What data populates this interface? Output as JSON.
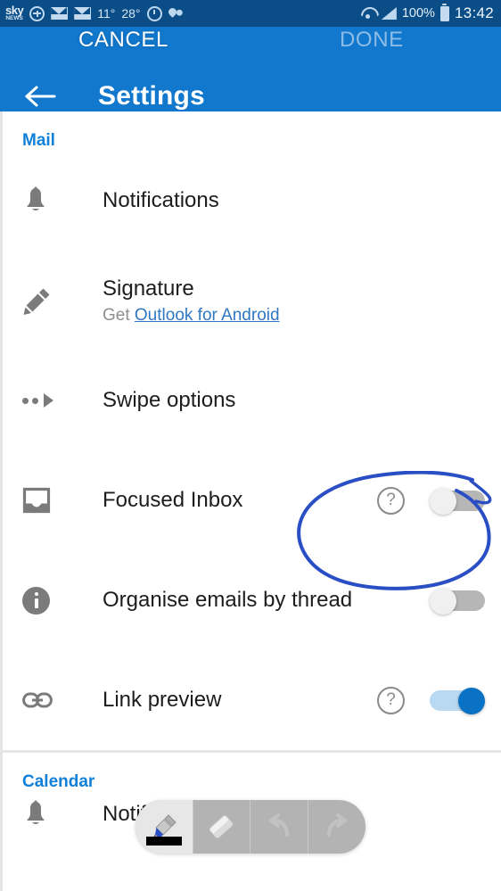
{
  "status_bar": {
    "app_logo_top": "sky",
    "app_logo_bottom": "NEWS",
    "sync_icon": "sync-icon",
    "mail_icon_1": "mail-icon",
    "mail_icon_2": "mail-icon",
    "temp_1": "11°",
    "temp_2": "28°",
    "alarm_icon": "alarm-icon",
    "location_icon": "location-pin-icon",
    "wifi_icon": "wifi-icon",
    "signal_icon": "cellular-signal-icon",
    "battery_percent": "100%",
    "battery_icon": "battery-icon",
    "clock": "13:42"
  },
  "edit_overlay": {
    "cancel_label": "CANCEL",
    "done_label": "DONE",
    "cancel_color": "#ffffff",
    "done_color": "#8dbde6"
  },
  "appbar": {
    "back_icon": "back-arrow-icon",
    "title": "Settings",
    "bg_color": "#1178cd"
  },
  "sections": [
    {
      "title": "Mail",
      "title_color": "#1180d8",
      "rows": [
        {
          "icon": "bell-icon",
          "label": "Notifications",
          "sub_prefix": "",
          "sub_link": "",
          "has_help": false,
          "toggle": null
        },
        {
          "icon": "pencil-icon",
          "label": "Signature",
          "sub_prefix": "Get ",
          "sub_link": "Outlook for Android",
          "has_help": false,
          "toggle": null
        },
        {
          "icon": "swipe-icon",
          "label": "Swipe options",
          "sub_prefix": "",
          "sub_link": "",
          "has_help": false,
          "toggle": null
        },
        {
          "icon": "inbox-icon",
          "label": "Focused Inbox",
          "sub_prefix": "",
          "sub_link": "",
          "has_help": true,
          "toggle": "off"
        },
        {
          "icon": "info-icon",
          "label": "Organise emails by thread",
          "sub_prefix": "",
          "sub_link": "",
          "has_help": false,
          "toggle": "off"
        },
        {
          "icon": "link-icon",
          "label": "Link preview",
          "sub_prefix": "",
          "sub_link": "",
          "has_help": true,
          "toggle": "on"
        }
      ]
    },
    {
      "title": "Calendar",
      "title_color": "#1180d8",
      "rows": [
        {
          "icon": "bell-icon",
          "label": "Notifications",
          "sub_prefix": "",
          "sub_link": "",
          "has_help": false,
          "toggle": null
        }
      ]
    }
  ],
  "help_icon_label": "?",
  "annotation": {
    "type": "hand-drawn-ellipse",
    "color": "#2a4fc4",
    "target": "focused-inbox-help-and-toggle"
  },
  "edit_toolbar": {
    "tools": [
      {
        "name": "pen-tool",
        "active": true,
        "swatch_color": "#000000"
      },
      {
        "name": "eraser-tool",
        "active": false
      },
      {
        "name": "undo-tool",
        "active": false
      },
      {
        "name": "redo-tool",
        "active": false
      }
    ],
    "bg_color": "#b3b3b3"
  }
}
